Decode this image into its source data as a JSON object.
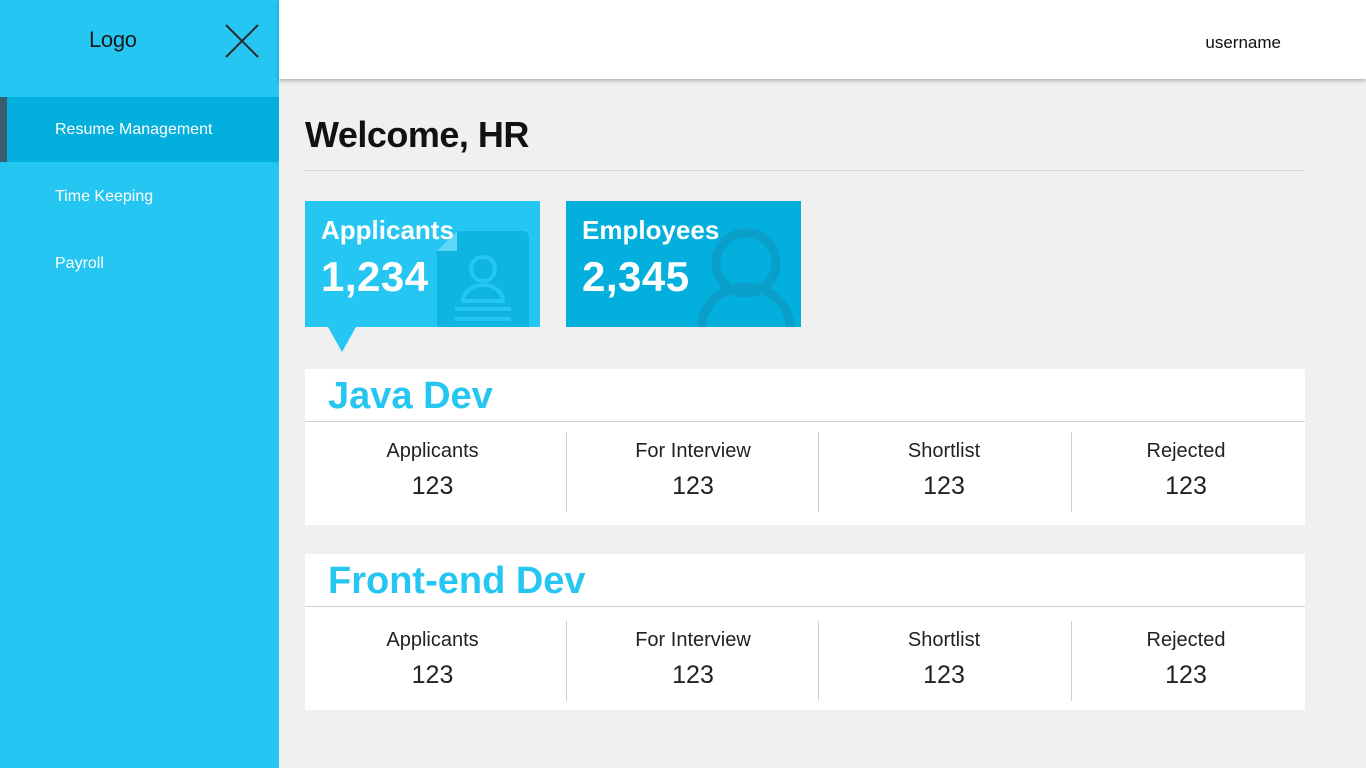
{
  "sidebar": {
    "logo": "Logo",
    "close_icon": "close-icon",
    "items": [
      {
        "label": "Resume Management",
        "active": true
      },
      {
        "label": "Time Keeping",
        "active": false
      },
      {
        "label": "Payroll",
        "active": false
      }
    ]
  },
  "header": {
    "username": "username"
  },
  "main": {
    "welcome": "Welcome, HR",
    "cards": [
      {
        "label": "Applicants",
        "value": "1,234",
        "icon": "resume-document-icon"
      },
      {
        "label": "Employees",
        "value": "2,345",
        "icon": "person-icon"
      }
    ],
    "jobs": [
      {
        "title": "Java Dev",
        "stats": [
          {
            "label": "Applicants",
            "value": "123"
          },
          {
            "label": "For Interview",
            "value": "123"
          },
          {
            "label": "Shortlist",
            "value": "123"
          },
          {
            "label": "Rejected",
            "value": "123"
          }
        ]
      },
      {
        "title": "Front-end Dev",
        "stats": [
          {
            "label": "Applicants",
            "value": "123"
          },
          {
            "label": "For Interview",
            "value": "123"
          },
          {
            "label": "Shortlist",
            "value": "123"
          },
          {
            "label": "Rejected",
            "value": "123"
          }
        ]
      }
    ]
  },
  "colors": {
    "sidebar": "#25c7f2",
    "sidebar_active": "#03afdc",
    "active_indicator": "#3a5c70",
    "accent": "#25c7f2",
    "background": "#f0f0f0"
  }
}
